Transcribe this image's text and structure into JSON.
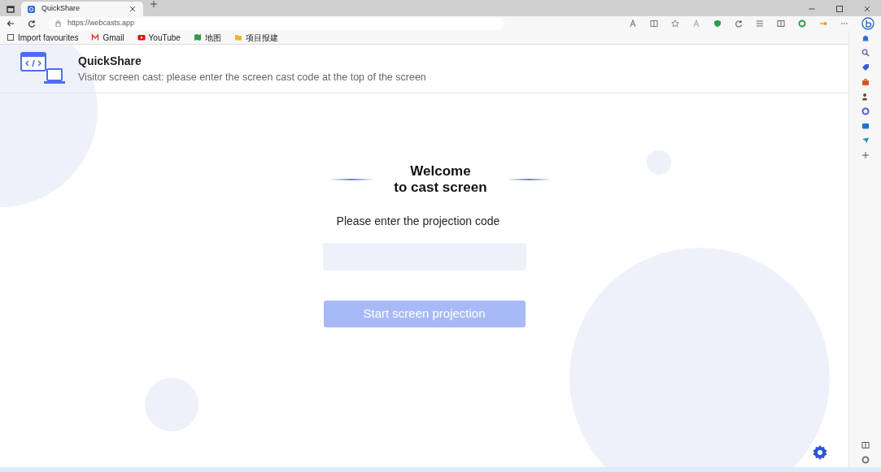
{
  "browser": {
    "tabs": [
      {
        "title": "QuickShare",
        "selected": true
      }
    ],
    "address": "https://webcasts.app",
    "bookmarks": [
      {
        "label": "Import favourites"
      },
      {
        "label": "Gmail"
      },
      {
        "label": "YouTube"
      },
      {
        "label": "地图"
      },
      {
        "label": "项目报建"
      }
    ]
  },
  "app": {
    "brand": "QuickShare",
    "subtitle": "Visitor screen cast: please enter the screen cast code at the top of the screen"
  },
  "welcome": {
    "title_line_1": "Welcome",
    "title_line_2": "to cast screen",
    "code_label": "Please enter the projection code",
    "start_button": {
      "label": "Start screen projection",
      "disabled": true
    }
  }
}
